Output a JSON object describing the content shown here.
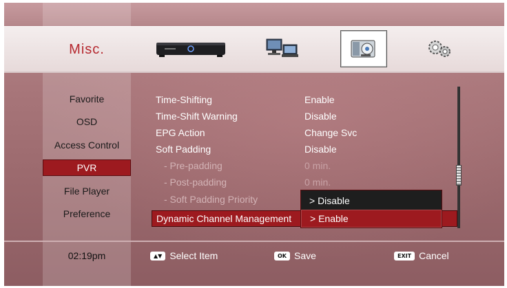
{
  "header": {
    "title": "Misc.",
    "categories": [
      {
        "icon": "set-top-box-icon",
        "selected": false
      },
      {
        "icon": "network-computers-icon",
        "selected": false
      },
      {
        "icon": "disk-settings-icon",
        "selected": true
      },
      {
        "icon": "gears-icon",
        "selected": false
      }
    ]
  },
  "sidebar": {
    "items": [
      {
        "label": "Favorite"
      },
      {
        "label": "OSD"
      },
      {
        "label": "Access Control"
      },
      {
        "label": "PVR",
        "active": true
      },
      {
        "label": "File Player"
      },
      {
        "label": "Preference"
      }
    ]
  },
  "settings": [
    {
      "label": "Time-Shifting",
      "value": "Enable"
    },
    {
      "label": "Time-Shift Warning",
      "value": "Disable"
    },
    {
      "label": "EPG Action",
      "value": "Change Svc"
    },
    {
      "label": "Soft Padding",
      "value": "Disable"
    },
    {
      "label": "- Pre-padding",
      "value": "0 min."
    },
    {
      "label": "- Post-padding",
      "value": "0 min."
    },
    {
      "label": "- Soft Padding Priority",
      "value": ""
    },
    {
      "label": "Dynamic Channel Management",
      "value": ""
    }
  ],
  "dropdown": {
    "options": [
      {
        "label": "> Disable"
      },
      {
        "label": "> Enable",
        "selected": true
      }
    ]
  },
  "footer": {
    "time": "02:19pm",
    "hints": [
      {
        "key": "▲▼",
        "label": "Select Item"
      },
      {
        "key": "OK",
        "label": "Save"
      },
      {
        "key": "EXIT",
        "label": "Cancel"
      }
    ]
  },
  "colors": {
    "accent": "#9d1a1f",
    "title": "#b5272e",
    "background": "#a8767a"
  }
}
